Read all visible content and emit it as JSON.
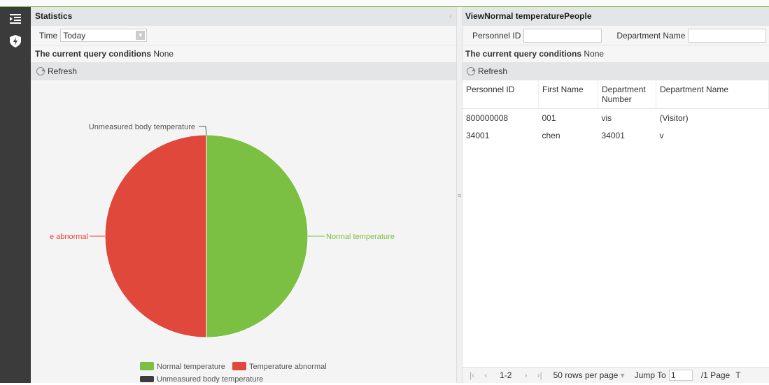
{
  "left": {
    "title": "Statistics",
    "time_label": "Time",
    "time_value": "Today",
    "conditions_label": "The current query conditions",
    "conditions_value": "None",
    "refresh_label": "Refresh"
  },
  "chart_data": {
    "type": "pie",
    "slices": [
      {
        "label": "Normal temperature",
        "value": 1,
        "color": "#7bc043"
      },
      {
        "label": "Temperature abnormal",
        "value": 1,
        "color": "#e0483b"
      },
      {
        "label": "Unmeasured body temperature",
        "value": 0,
        "color": "#3d3d3d"
      }
    ],
    "slice_labels": {
      "normal": "Normal temperature",
      "abnormal": "e abnormal",
      "unmeasured": "Unmeasured body temperature"
    },
    "legend": [
      {
        "label": "Normal temperature",
        "color": "#7bc043"
      },
      {
        "label": "Temperature abnormal",
        "color": "#e0483b"
      },
      {
        "label": "Unmeasured body temperature",
        "color": "#3d3d3d"
      }
    ],
    "legend_position": "bottom"
  },
  "right": {
    "title": "ViewNormal temperaturePeople",
    "personnel_id_label": "Personnel ID",
    "department_name_label": "Department Name",
    "conditions_label": "The current query conditions",
    "conditions_value": "None",
    "refresh_label": "Refresh",
    "columns": [
      "Personnel ID",
      "First Name",
      "Department Number",
      "Department Name"
    ],
    "rows": [
      [
        "800000008",
        "001",
        "vis",
        "(Visitor)"
      ],
      [
        "34001",
        "chen",
        "34001",
        "v"
      ]
    ],
    "pager": {
      "range": "1-2",
      "rows_per_page": "50 rows per page",
      "jump_to_label": "Jump To",
      "jump_value": "1",
      "page_total": "/1 Page",
      "trailing": "T"
    }
  },
  "colors": {
    "accent_green": "#7bc043",
    "abnormal_red": "#e0483b",
    "rail_dark": "#3b3b3b"
  }
}
